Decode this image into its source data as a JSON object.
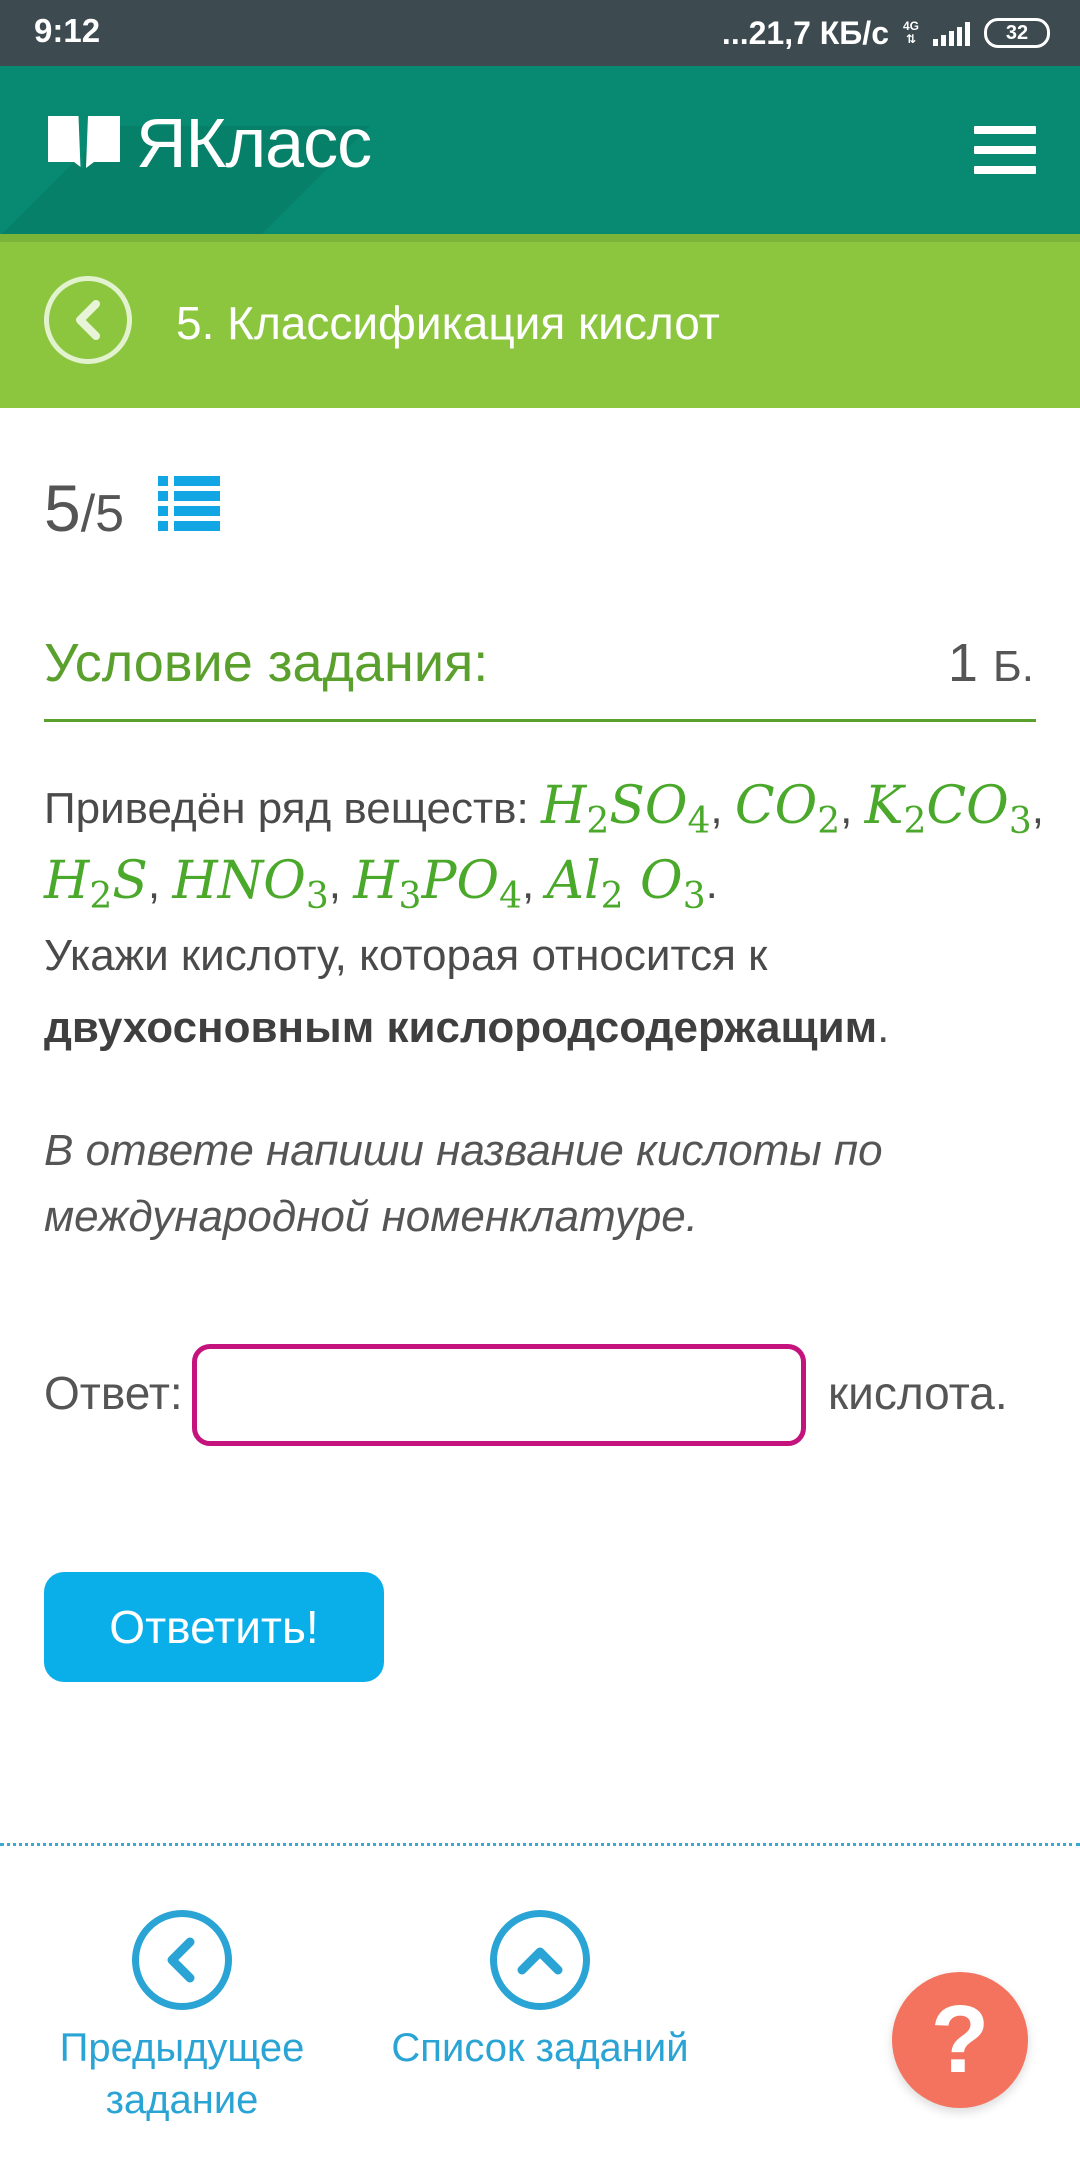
{
  "status_bar": {
    "time": "9:12",
    "network_speed": "...21,7 КБ/с",
    "network_type": "4G",
    "battery": "32"
  },
  "header": {
    "logo_text": "ЯКласс",
    "brand_color": "#078a71",
    "menu_icon": "hamburger-icon"
  },
  "topic": {
    "title": "5. Классификация кислот",
    "back_icon": "chevron-left-icon",
    "bar_color": "#8cc63f"
  },
  "progress": {
    "current": "5",
    "total": "/5",
    "list_icon": "list-icon"
  },
  "condition": {
    "title": "Условие задания:",
    "points": "1",
    "points_unit": "Б."
  },
  "task": {
    "intro": "Приведён ряд веществ:",
    "substances": [
      {
        "parts": [
          "H",
          "2",
          "SO",
          "4"
        ]
      },
      {
        "parts": [
          "CO",
          "2"
        ]
      },
      {
        "parts": [
          "K",
          "2",
          "CO",
          "3"
        ]
      },
      {
        "parts": [
          "H",
          "2",
          "S"
        ]
      },
      {
        "parts": [
          "HNO",
          "3"
        ]
      },
      {
        "parts": [
          "H",
          "3",
          "PO",
          "4"
        ]
      },
      {
        "parts": [
          "Al",
          "2",
          " O",
          "3"
        ]
      }
    ],
    "question_prefix": "Укажи кислоту, которая относится к",
    "question_bold": "двухосновным кислородсодержащим",
    "question_end": ".",
    "hint": "В ответе напиши название кислоты по международной номенклатуре."
  },
  "answer": {
    "label": "Ответ:",
    "value": "",
    "suffix": "кислота.",
    "border_color": "#c4137d"
  },
  "submit": {
    "label": "Ответить!",
    "color": "#0aaee8"
  },
  "bottom_nav": {
    "prev_label_line1": "Предыдущее",
    "prev_label_line2": "задание",
    "list_label": "Список заданий",
    "help_label": "?"
  }
}
